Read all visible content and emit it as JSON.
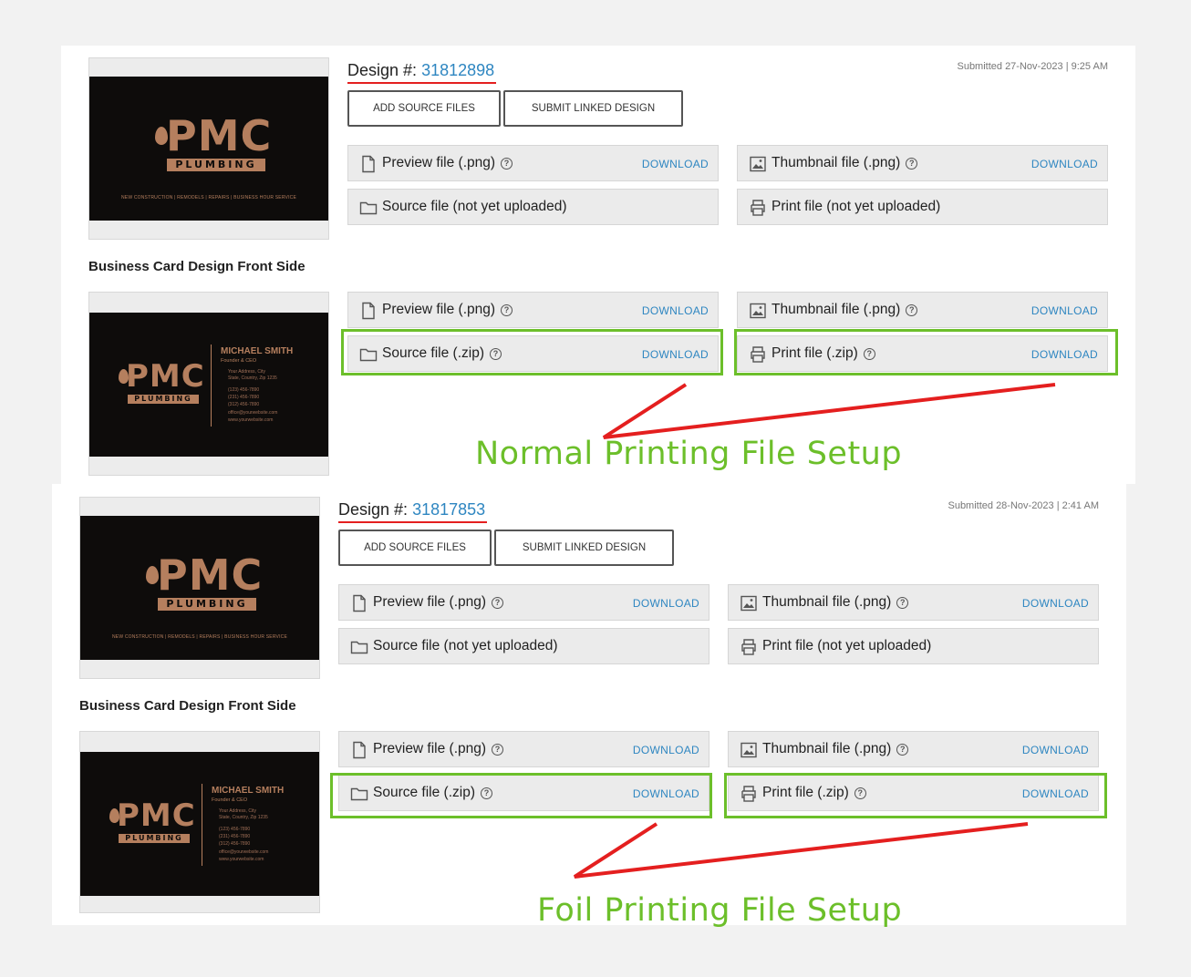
{
  "sections": [
    {
      "design_label": "Design #:",
      "design_number": "31812898",
      "submitted": "Submitted 27-Nov-2023 | 9:25 AM",
      "buttons": {
        "add_source": "ADD SOURCE FILES",
        "submit_linked": "SUBMIT LINKED DESIGN"
      },
      "rows_top": [
        {
          "label": "Preview file (.png)",
          "download": "DOWNLOAD"
        },
        {
          "label": "Thumbnail file (.png)",
          "download": "DOWNLOAD"
        },
        {
          "label": "Source file (not yet uploaded)"
        },
        {
          "label": "Print file (not yet uploaded)"
        }
      ],
      "caption": "Business Card Design Front Side",
      "rows_bottom": [
        {
          "label": "Preview file (.png)",
          "download": "DOWNLOAD"
        },
        {
          "label": "Thumbnail file (.png)",
          "download": "DOWNLOAD"
        },
        {
          "label": "Source file (.zip)",
          "download": "DOWNLOAD"
        },
        {
          "label": "Print file (.zip)",
          "download": "DOWNLOAD"
        }
      ],
      "heading": "Normal Printing File Setup"
    },
    {
      "design_label": "Design #:",
      "design_number": "31817853",
      "submitted": "Submitted 28-Nov-2023 | 2:41 AM",
      "buttons": {
        "add_source": "ADD SOURCE FILES",
        "submit_linked": "SUBMIT LINKED DESIGN"
      },
      "rows_top": [
        {
          "label": "Preview file (.png)",
          "download": "DOWNLOAD"
        },
        {
          "label": "Thumbnail file (.png)",
          "download": "DOWNLOAD"
        },
        {
          "label": "Source file (not yet uploaded)"
        },
        {
          "label": "Print file (not yet uploaded)"
        }
      ],
      "caption": "Business Card Design Front Side",
      "rows_bottom": [
        {
          "label": "Preview file (.png)",
          "download": "DOWNLOAD"
        },
        {
          "label": "Thumbnail file (.png)",
          "download": "DOWNLOAD"
        },
        {
          "label": "Source file (.zip)",
          "download": "DOWNLOAD"
        },
        {
          "label": "Print file (.zip)",
          "download": "DOWNLOAD"
        }
      ],
      "heading": "Foil Printing File Setup"
    }
  ],
  "card": {
    "logo_text": "PMC",
    "logo_sub": "PLUMBING",
    "front_tagline": "NEW CONSTRUCTION | REMODELS | REPAIRS | BUSINESS HOUR SERVICE",
    "name": "MICHAEL SMITH",
    "role": "Founder & CEO",
    "address1": "Your Address, City",
    "address2": "State, Country, Zip 1235",
    "phone1": "(123) 456-7890",
    "phone2": "(231) 456-7890",
    "phone3": "(312) 456-7890",
    "email": "office@yourwebsite.com",
    "web": "www.yourwebsite.com"
  },
  "colors": {
    "accent_blue": "#2e86c1",
    "highlight_green": "#6cbf2a",
    "annotation_red": "#e41f1f",
    "card_copper": "#b57f5e"
  },
  "icons": [
    "file-icon",
    "folder-icon",
    "image-icon",
    "printer-icon",
    "help-icon"
  ]
}
